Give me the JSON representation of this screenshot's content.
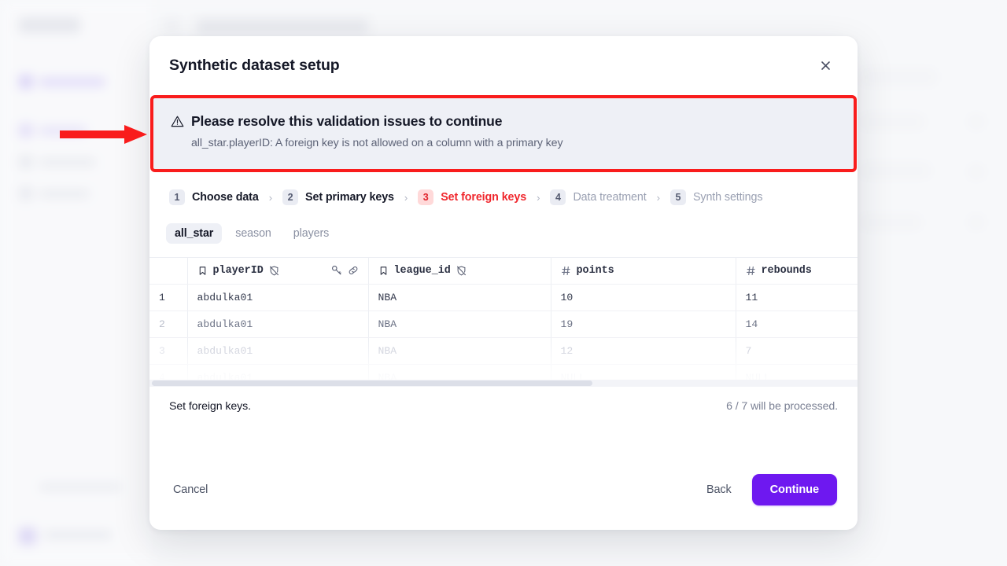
{
  "modal": {
    "title": "Synthetic dataset setup",
    "close_icon": "close-icon"
  },
  "alert": {
    "icon": "warning-triangle-icon",
    "heading": "Please resolve this validation issues to continue",
    "detail": "all_star.playerID: A foreign key is not allowed on a column with a primary key",
    "border_color": "#f91c1c",
    "background_color": "#eef0f6"
  },
  "stepper": {
    "separator": "›",
    "steps": [
      {
        "num": "1",
        "label": "Choose data",
        "state": "done"
      },
      {
        "num": "2",
        "label": "Set primary keys",
        "state": "done"
      },
      {
        "num": "3",
        "label": "Set foreign keys",
        "state": "active"
      },
      {
        "num": "4",
        "label": "Data treatment",
        "state": "upcoming"
      },
      {
        "num": "5",
        "label": "Synth settings",
        "state": "upcoming"
      }
    ]
  },
  "table_tabs": [
    {
      "label": "all_star",
      "active": true
    },
    {
      "label": "season",
      "active": false
    },
    {
      "label": "players",
      "active": false
    }
  ],
  "grid": {
    "columns": [
      {
        "name": "playerID",
        "type_icon": "bookmark-icon",
        "flag_icon": "shield-off-icon",
        "actions": [
          "key-icon",
          "link-icon"
        ]
      },
      {
        "name": "league_id",
        "type_icon": "bookmark-icon",
        "flag_icon": "shield-off-icon",
        "actions": []
      },
      {
        "name": "points",
        "type_icon": "hash-icon",
        "flag_icon": null,
        "actions": []
      },
      {
        "name": "rebounds",
        "type_icon": "hash-icon",
        "flag_icon": null,
        "actions": []
      }
    ],
    "rows": [
      {
        "n": "1",
        "playerID": "abdulka01",
        "league_id": "NBA",
        "points": "10",
        "rebounds": "11"
      },
      {
        "n": "2",
        "playerID": "abdulka01",
        "league_id": "NBA",
        "points": "19",
        "rebounds": "14"
      },
      {
        "n": "3",
        "playerID": "abdulka01",
        "league_id": "NBA",
        "points": "12",
        "rebounds": "7"
      },
      {
        "n": "4",
        "playerID": "abdulka01",
        "league_id": "NBA",
        "points": "NULL",
        "rebounds": "NULL"
      }
    ]
  },
  "status": {
    "left": "Set foreign keys.",
    "right": "6 / 7 will be processed."
  },
  "actions": {
    "cancel": "Cancel",
    "back": "Back",
    "continue": "Continue",
    "continue_color": "#6e18f0"
  },
  "annotation": {
    "arrow_color": "#f91c1c",
    "arrow_name": "red-pointer-arrow"
  }
}
